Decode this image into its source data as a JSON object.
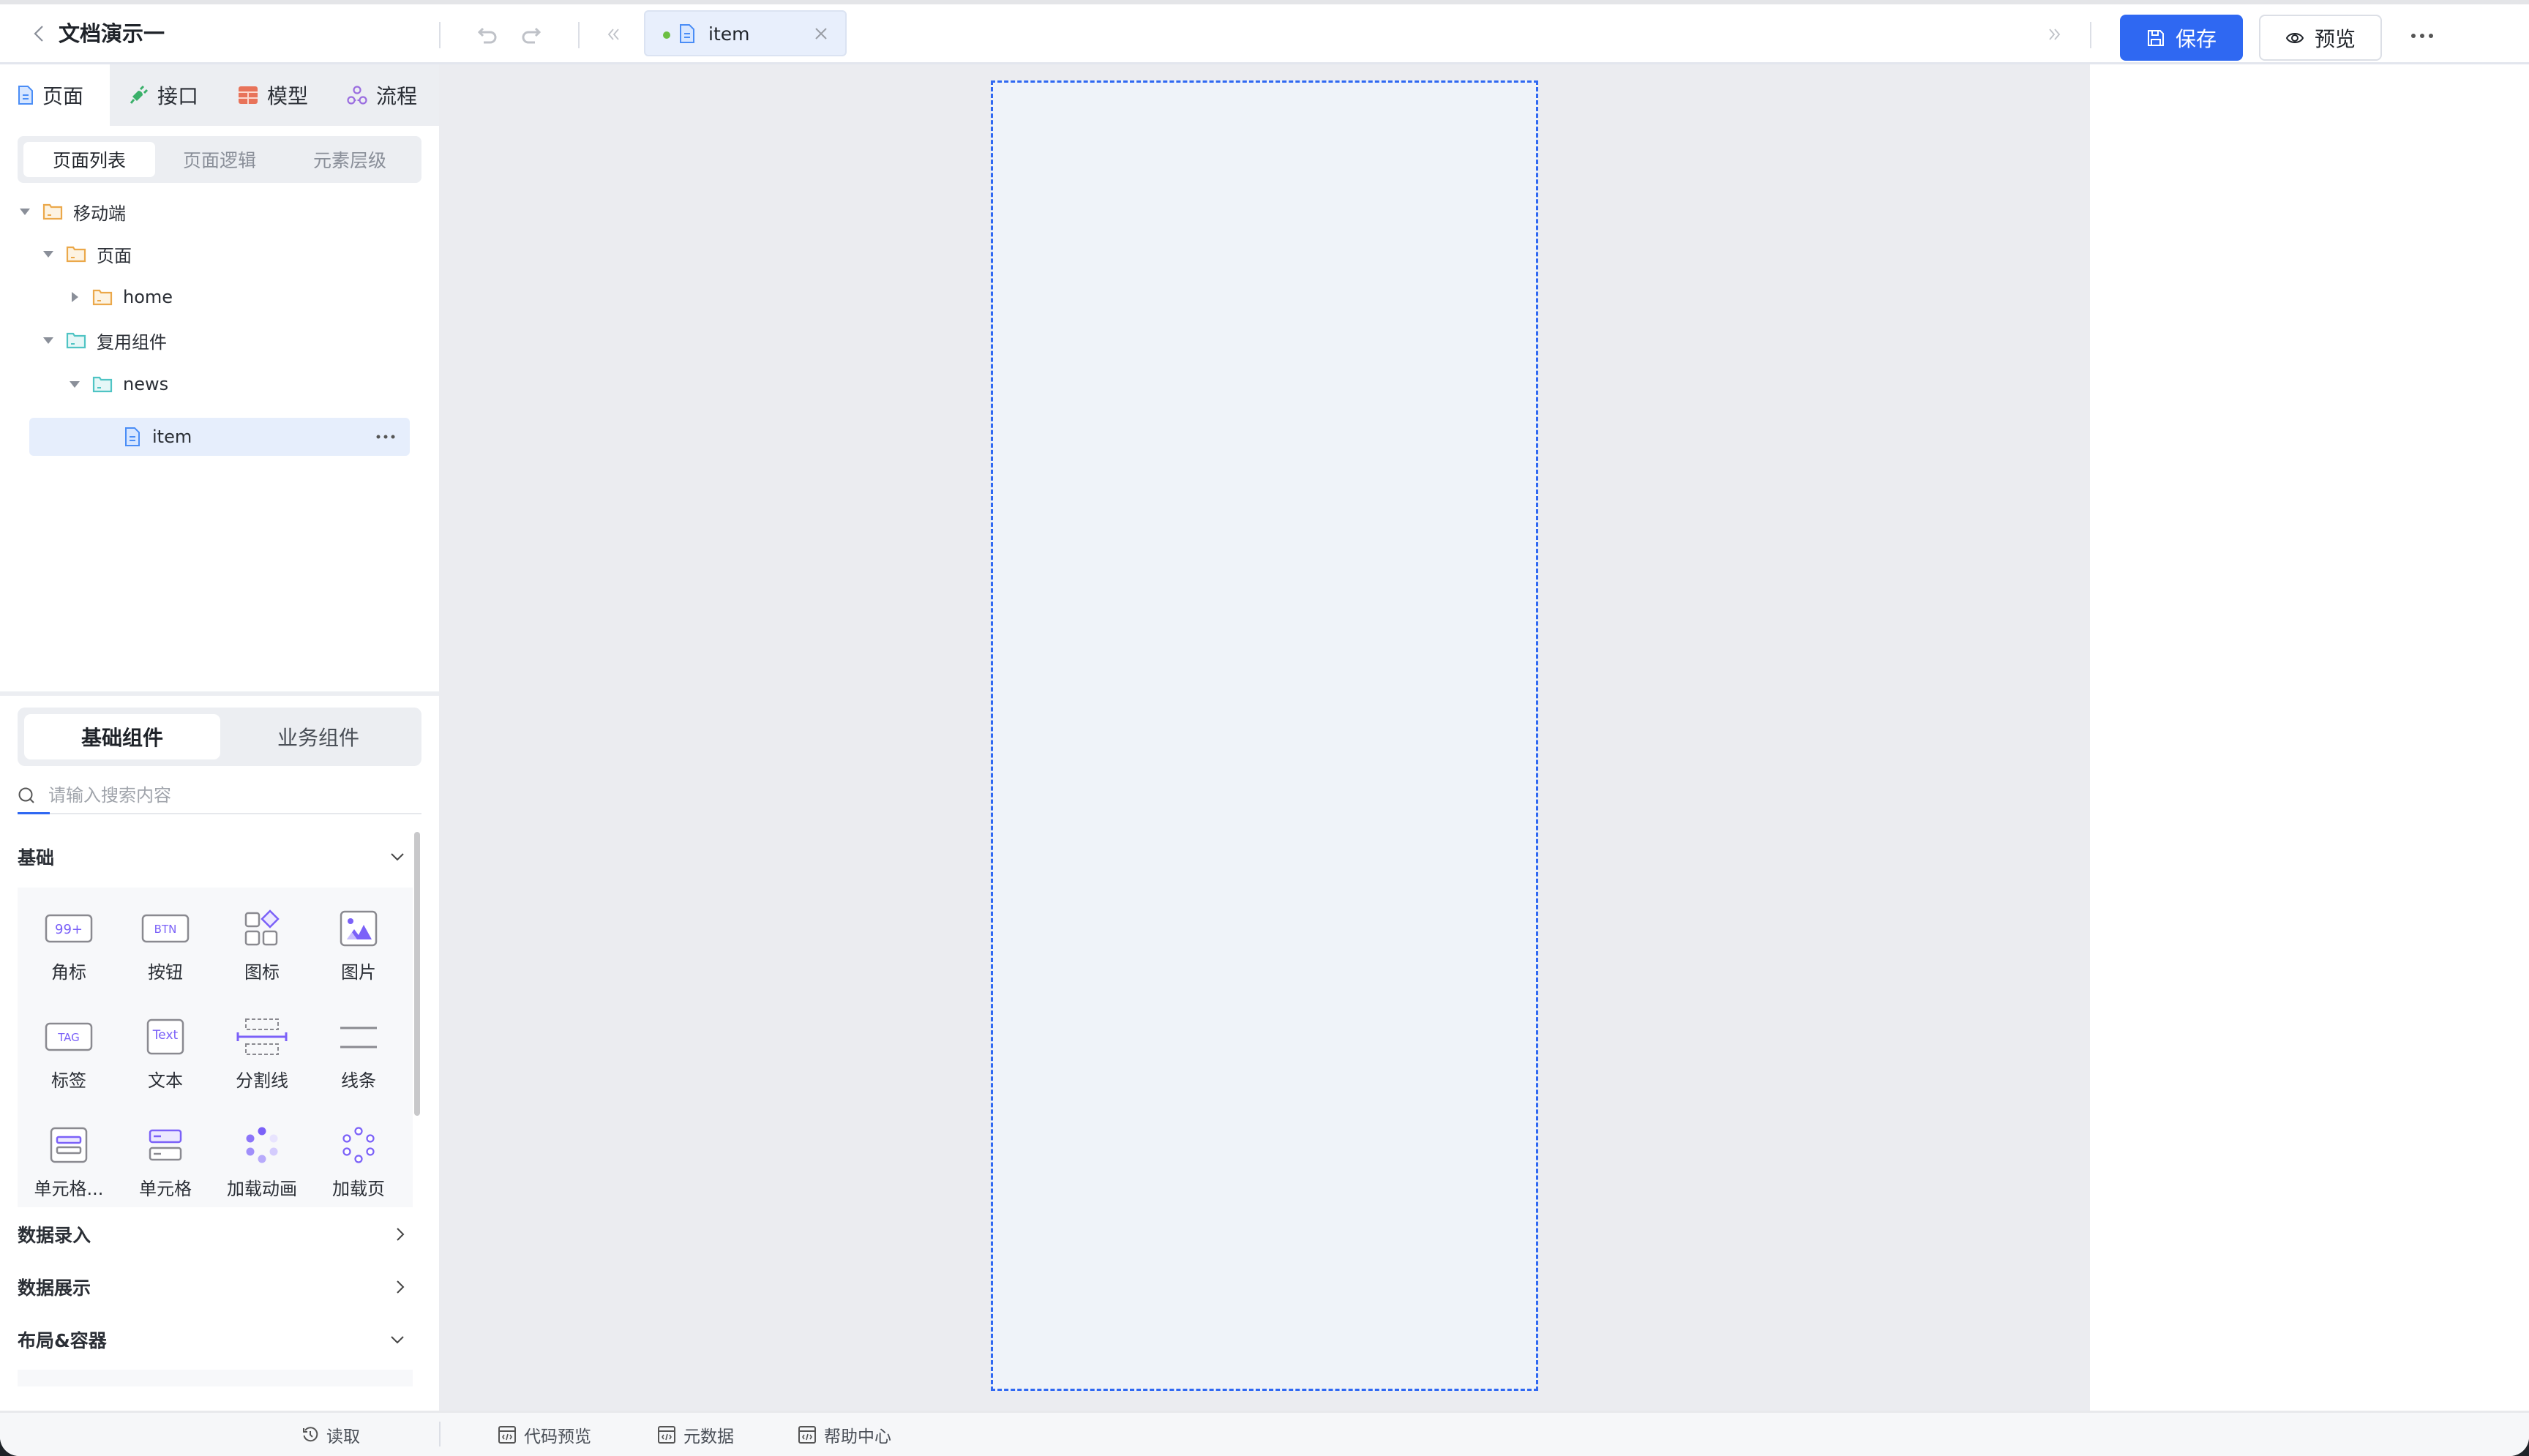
{
  "header": {
    "title": "文档演示一",
    "open_tab": {
      "label": "item",
      "status_color": "#6cbf43"
    },
    "save_label": "保存",
    "preview_label": "预览",
    "accent": "#2f68f2"
  },
  "left_tabs": [
    {
      "label": "页面",
      "icon": "page-icon",
      "active": true
    },
    {
      "label": "接口",
      "icon": "plug-icon",
      "active": false
    },
    {
      "label": "模型",
      "icon": "table-icon",
      "active": false
    },
    {
      "label": "流程",
      "icon": "flow-icon",
      "active": false
    }
  ],
  "segmented": [
    {
      "label": "页面列表",
      "active": true
    },
    {
      "label": "页面逻辑",
      "active": false
    },
    {
      "label": "元素层级",
      "active": false
    }
  ],
  "tree": [
    {
      "label": "移动端",
      "level": 0,
      "expanded": true,
      "type": "folder-orange"
    },
    {
      "label": "页面",
      "level": 1,
      "expanded": true,
      "type": "folder-orange"
    },
    {
      "label": "home",
      "level": 2,
      "expanded": false,
      "type": "folder-orange"
    },
    {
      "label": "复用组件",
      "level": 1,
      "expanded": true,
      "type": "folder-teal"
    },
    {
      "label": "news",
      "level": 2,
      "expanded": true,
      "type": "folder-teal"
    },
    {
      "label": "item",
      "level": 3,
      "type": "file",
      "selected": true
    }
  ],
  "component_tabs": [
    {
      "label": "基础组件",
      "active": true
    },
    {
      "label": "业务组件",
      "active": false
    }
  ],
  "search": {
    "placeholder": "请输入搜索内容",
    "value": ""
  },
  "categories": [
    {
      "label": "基础",
      "expanded": true
    },
    {
      "label": "数据录入",
      "expanded": false
    },
    {
      "label": "数据展示",
      "expanded": false
    },
    {
      "label": "布局&容器",
      "expanded": true
    }
  ],
  "components": [
    {
      "label": "角标",
      "icon": "badge-icon",
      "glyph": "99+"
    },
    {
      "label": "按钮",
      "icon": "button-icon",
      "glyph": "BTN"
    },
    {
      "label": "图标",
      "icon": "icons-grid-icon"
    },
    {
      "label": "图片",
      "icon": "image-icon"
    },
    {
      "label": "标签",
      "icon": "tag-icon",
      "glyph": "TAG"
    },
    {
      "label": "文本",
      "icon": "text-icon",
      "glyph": "Text"
    },
    {
      "label": "分割线",
      "icon": "divider-icon"
    },
    {
      "label": "线条",
      "icon": "lines-icon"
    },
    {
      "label": "单元格...",
      "icon": "cell-group-icon"
    },
    {
      "label": "单元格",
      "icon": "cell-icon"
    },
    {
      "label": "加载动画",
      "icon": "loading-icon"
    },
    {
      "label": "加载页",
      "icon": "loading-page-icon"
    }
  ],
  "bottom_bar": [
    {
      "label": "读取",
      "icon": "history-icon"
    },
    {
      "label": "代码预览",
      "icon": "code-icon"
    },
    {
      "label": "元数据",
      "icon": "code-icon"
    },
    {
      "label": "帮助中心",
      "icon": "code-icon"
    }
  ]
}
